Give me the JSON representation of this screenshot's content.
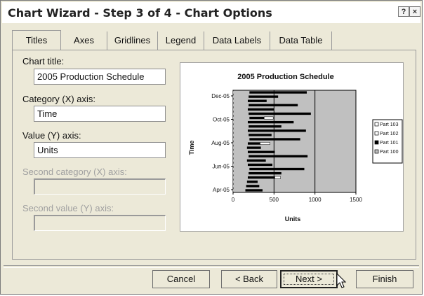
{
  "window": {
    "title": "Chart Wizard - Step 3 of 4 - Chart Options",
    "help_label": "?",
    "close_label": "×"
  },
  "tabs": [
    {
      "label": "Titles",
      "active": true
    },
    {
      "label": "Axes"
    },
    {
      "label": "Gridlines"
    },
    {
      "label": "Legend"
    },
    {
      "label": "Data Labels"
    },
    {
      "label": "Data Table"
    }
  ],
  "form": {
    "chart_title_label": "Chart title:",
    "chart_title_value": "2005 Production Schedule",
    "category_label": "Category (X) axis:",
    "category_value": "Time",
    "value_label": "Value (Y) axis:",
    "value_value": "Units",
    "second_category_label": "Second category (X) axis:",
    "second_value_label": "Second value (Y) axis:"
  },
  "buttons": {
    "cancel": "Cancel",
    "back": "< Back",
    "next": "Next >",
    "finish": "Finish"
  },
  "chart_data": {
    "type": "bar",
    "orientation": "horizontal",
    "stacked": true,
    "title": "2005 Production Schedule",
    "xlabel": "Units",
    "ylabel": "Time",
    "xlim": [
      0,
      1500
    ],
    "x_ticks": [
      "0",
      "500",
      "1000",
      "1500"
    ],
    "y_tick_labels": [
      "Apr-05",
      "Jun-05",
      "Aug-05",
      "Oct-05",
      "Dec-05"
    ],
    "legend": [
      "Part 103",
      "Part 102",
      "Part 101",
      "Part 100"
    ],
    "legend_position": "right",
    "colors": {
      "Part 100": "#c0c0c0",
      "Part 101": "#000000",
      "Part 102": "#ffffff",
      "Part 103": "#ffffff"
    },
    "plot_background": "#c0c0c0",
    "bars": [
      {
        "p100": 150,
        "p101": 210
      },
      {
        "p100": 160,
        "p101": 160
      },
      {
        "p100": 170,
        "p101": 130
      },
      {
        "p100": 180,
        "p101": 330,
        "p102": 70
      },
      {
        "p100": 190,
        "p101": 400
      },
      {
        "p100": 200,
        "p101": 670
      },
      {
        "p100": 180,
        "p101": 300
      },
      {
        "p100": 170,
        "p101": 230
      },
      {
        "p100": 190,
        "p101": 720
      },
      {
        "p100": 180,
        "p101": 330
      },
      {
        "p100": 170,
        "p101": 170
      },
      {
        "p100": 180,
        "p101": 150,
        "p102": 120
      },
      {
        "p100": 200,
        "p101": 620
      },
      {
        "p100": 190,
        "p101": 280
      },
      {
        "p100": 180,
        "p101": 710
      },
      {
        "p100": 190,
        "p101": 400
      },
      {
        "p100": 180,
        "p101": 560
      },
      {
        "p100": 200,
        "p101": 180,
        "p102": 110
      },
      {
        "p100": 190,
        "p101": 760
      },
      {
        "p100": 180,
        "p101": 320
      },
      {
        "p100": 190,
        "p101": 600
      },
      {
        "p100": 180,
        "p101": 230
      },
      {
        "p100": 190,
        "p101": 360
      },
      {
        "p100": 200,
        "p101": 700
      }
    ]
  }
}
